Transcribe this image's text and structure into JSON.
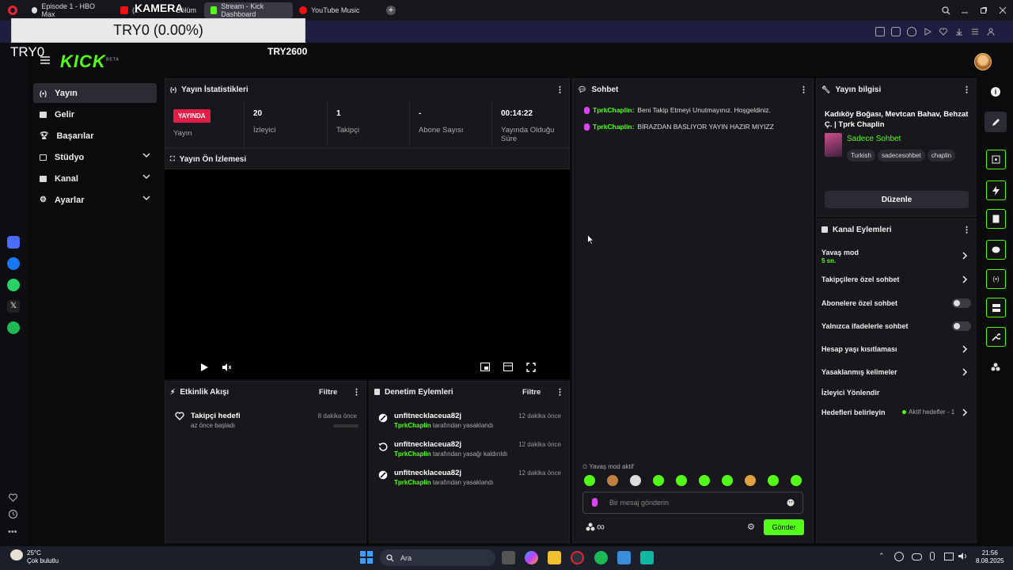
{
  "browser": {
    "tabs": [
      {
        "label": "Episode 1 - HBO Max"
      },
      {
        "label": "(2"
      },
      {
        "label": "Bölüm"
      },
      {
        "label": "Stream - Kick Dashboard"
      },
      {
        "label": "YouTube Music"
      }
    ]
  },
  "overlay": {
    "camera": "KAMERA",
    "price_box": "TRY0 (0.00%)",
    "try0": "TRY0",
    "try2600": "TRY2600"
  },
  "logo": "KICK",
  "logo_badge": "BETA",
  "nav": [
    {
      "label": "Yayın"
    },
    {
      "label": "Gelir"
    },
    {
      "label": "Başarılar"
    },
    {
      "label": "Stüdyo"
    },
    {
      "label": "Kanal"
    },
    {
      "label": "Ayarlar"
    }
  ],
  "stats": {
    "title": "Yayın İstatistikleri",
    "live_badge": "YAYINDA",
    "live_label": "Yayın",
    "viewers": {
      "value": "20",
      "label": "İzleyici"
    },
    "followers": {
      "value": "1",
      "label": "Takipçi"
    },
    "subs": {
      "value": "-",
      "label": "Abone Sayısı"
    },
    "duration": {
      "value": "00:14:22",
      "label_1": "Yayında Olduğu",
      "label_2": "Süre"
    }
  },
  "preview": {
    "title": "Yayın Ön İzlemesi"
  },
  "activity": {
    "title": "Etkinlik Akışı",
    "filter": "Filtre",
    "items": [
      {
        "title": "Takipçi hedefi",
        "sub": "az önce başladı",
        "time": "8 dakika önce"
      }
    ]
  },
  "moderation": {
    "title": "Denetim Eylemleri",
    "filter": "Filtre",
    "by_user": "TprkChaplin",
    "items": [
      {
        "user": "unfitnecklaceua82j",
        "action": "tarafından yasaklandı",
        "time": "12 dakika önce"
      },
      {
        "user": "unfitnecklaceua82j",
        "action": "tarafından yasağı kaldırıldı",
        "time": "12 dakika önce"
      },
      {
        "user": "unfitnecklaceua82j",
        "action": "tarafından yasaklandı",
        "time": "12 dakika önce"
      }
    ]
  },
  "chat": {
    "title": "Sohbet",
    "messages": [
      {
        "user": "TprkChaplin:",
        "text": "Beni Takip Etmeyi Unutmayınız. Hoşgeldiniz."
      },
      {
        "user": "TprkChaplin:",
        "text": "BİRAZDAN BASLIYOR YAYIN HAZIR MIYIZZ"
      }
    ],
    "slow_mode_notice": "Yavaş mod aktif",
    "input_placeholder": "Bir mesaj gönderin",
    "send": "Gönder",
    "infinity": "∞"
  },
  "stream_info": {
    "title": "Yayın bilgisi",
    "stream_title_1": "Kadıköy Boğası, Mevtcan Bahav, Behzat",
    "stream_title_2": "Ç. | Tprk Chaplin",
    "category": "Sadece Sohbet",
    "tags": [
      "Turkish",
      "sadecesohbet",
      "chaplin"
    ],
    "edit": "Düzenle"
  },
  "channel_actions": {
    "title": "Kanal Eylemleri",
    "slow_mode": "Yavaş mod",
    "slow_mode_sub": "5 sn.",
    "followers_only": "Takipçilere özel sohbet",
    "subs_only": "Abonelere özel sohbet",
    "emotes_only": "Yalnızca ifadelerle sohbet",
    "age_restriction": "Hesap yaşı kısıtlaması",
    "banned_words": "Yasaklanmış kelimeler",
    "raid": "İzleyici Yönlendir",
    "goals": "Hedefleri belirleyin",
    "goals_active": "Aktif hedefler - 1"
  },
  "taskbar": {
    "weather_temp": "25°C",
    "weather_desc": "Çok bulutlu",
    "search": "Ara",
    "time": "21:56",
    "date": "8.08.2025"
  },
  "colors": {
    "accent": "#53fc18",
    "live": "#e11d48",
    "mic": "#d946ef"
  }
}
